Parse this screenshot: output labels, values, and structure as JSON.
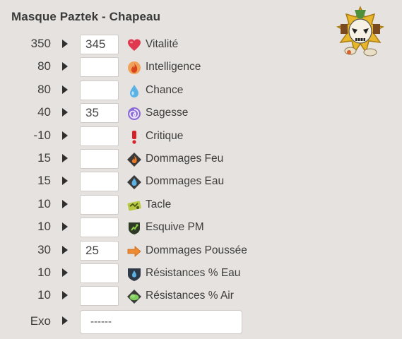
{
  "title": "Masque Paztek - Chapeau",
  "item_icon": "masque-paztek-icon",
  "stats": [
    {
      "base": "350",
      "value": "345",
      "label": "Vitalité",
      "icon": "heart-icon"
    },
    {
      "base": "80",
      "value": "",
      "label": "Intelligence",
      "icon": "fire-icon"
    },
    {
      "base": "80",
      "value": "",
      "label": "Chance",
      "icon": "water-drop-icon"
    },
    {
      "base": "40",
      "value": "35",
      "label": "Sagesse",
      "icon": "swirl-icon"
    },
    {
      "base": "-10",
      "value": "",
      "label": "Critique",
      "icon": "exclamation-icon"
    },
    {
      "base": "15",
      "value": "",
      "label": "Dommages Feu",
      "icon": "fire-damage-icon"
    },
    {
      "base": "15",
      "value": "",
      "label": "Dommages Eau",
      "icon": "water-damage-icon"
    },
    {
      "base": "10",
      "value": "",
      "label": "Tacle",
      "icon": "tackle-icon"
    },
    {
      "base": "10",
      "value": "",
      "label": "Esquive PM",
      "icon": "dodge-mp-icon"
    },
    {
      "base": "30",
      "value": "25",
      "label": "Dommages Poussée",
      "icon": "push-arrow-icon"
    },
    {
      "base": "10",
      "value": "",
      "label": "Résistances % Eau",
      "icon": "water-resist-icon"
    },
    {
      "base": "10",
      "value": "",
      "label": "Résistances % Air",
      "icon": "air-resist-icon"
    }
  ],
  "exo": {
    "label": "Exo",
    "value": "------"
  }
}
